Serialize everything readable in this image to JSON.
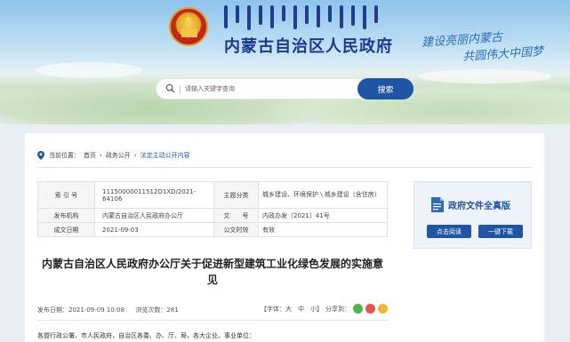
{
  "header": {
    "site_title": "内蒙古自治区人民政府",
    "slogan_line1": "建设亮丽内蒙古",
    "slogan_line2": "共圆伟大中国梦"
  },
  "search": {
    "placeholder": "请输入关键字查询",
    "button_label": "搜索"
  },
  "breadcrumb": {
    "prefix": "当前位置：",
    "items": [
      "首页",
      "政务公开",
      "法定主动公开内容"
    ]
  },
  "meta_table": {
    "rows": [
      {
        "k1": "索 引 号",
        "v1": "11150000011512O1XD/2021-64106",
        "k2": "主题分类",
        "v2": "城乡建设、环境保护 \\ 城乡建设（含住房）"
      },
      {
        "k1": "发布机构",
        "v1": "内蒙古自治区人民政府办公厅",
        "k2": "文　　号",
        "v2": "内政办发〔2021〕41号"
      },
      {
        "k1": "成文日期",
        "v1": "2021-09-03",
        "k2": "公文时效",
        "v2": "有效"
      }
    ]
  },
  "sidebar": {
    "title": "政府文件全真版",
    "btn_read": "点击阅读",
    "btn_download": "一键下载"
  },
  "article": {
    "title": "内蒙古自治区人民政府办公厅关于促进新型建筑工业化绿色发展的实施意见",
    "publish_time": "发布日期：2021-09-09 10:08",
    "views": "浏览次数：281",
    "font_size_label": "【字体：大　中　小】",
    "share_label": "分享到：",
    "body_first_line": "各盟行政公署、市人民政府，自治区各委、办、厅、局，各大企业、事业单位："
  },
  "colors": {
    "brand_blue": "#1f55a4",
    "title_blue": "#1c3a8f"
  }
}
